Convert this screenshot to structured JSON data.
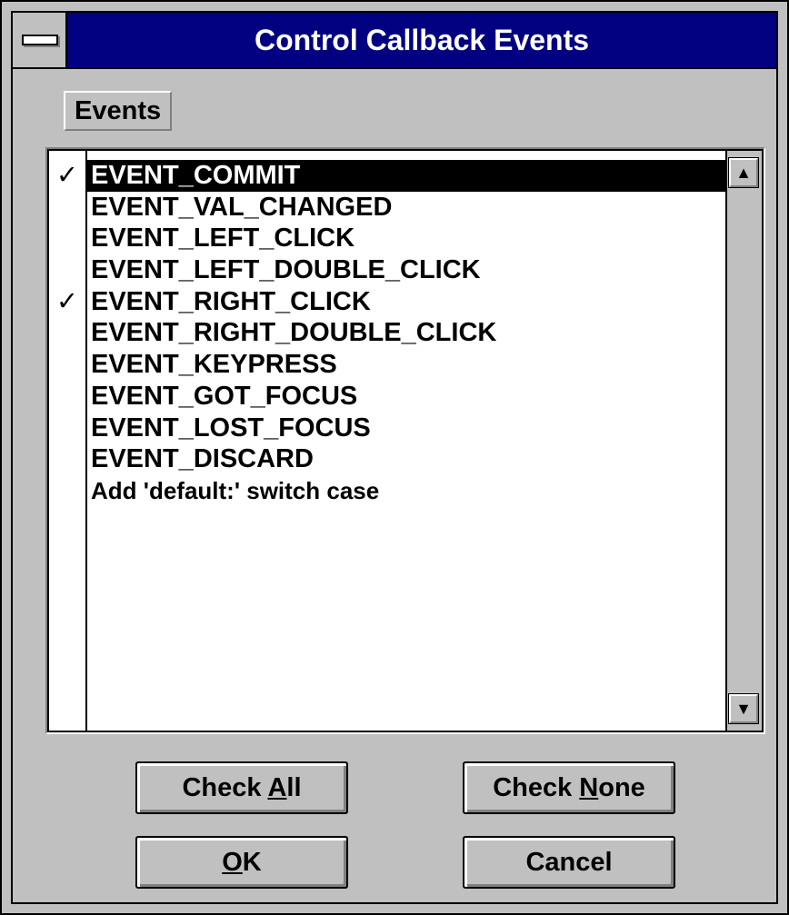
{
  "window": {
    "title": "Control Callback Events"
  },
  "group_label": "Events",
  "events": [
    {
      "label": "EVENT_COMMIT",
      "checked": true,
      "selected": true
    },
    {
      "label": "EVENT_VAL_CHANGED",
      "checked": false,
      "selected": false
    },
    {
      "label": "EVENT_LEFT_CLICK",
      "checked": false,
      "selected": false
    },
    {
      "label": "EVENT_LEFT_DOUBLE_CLICK",
      "checked": false,
      "selected": false
    },
    {
      "label": "EVENT_RIGHT_CLICK",
      "checked": true,
      "selected": false
    },
    {
      "label": "EVENT_RIGHT_DOUBLE_CLICK",
      "checked": false,
      "selected": false
    },
    {
      "label": "EVENT_KEYPRESS",
      "checked": false,
      "selected": false
    },
    {
      "label": "EVENT_GOT_FOCUS",
      "checked": false,
      "selected": false
    },
    {
      "label": "EVENT_LOST_FOCUS",
      "checked": false,
      "selected": false
    },
    {
      "label": "EVENT_DISCARD",
      "checked": false,
      "selected": false
    },
    {
      "label": "Add 'default:' switch case",
      "checked": false,
      "selected": false
    }
  ],
  "check_mark": "✓",
  "scrollbar": {
    "up_icon": "▲",
    "down_icon": "▼"
  },
  "buttons": {
    "check_all": {
      "pre": "Check ",
      "mnemonic": "A",
      "post": "ll"
    },
    "check_none": {
      "pre": "Check ",
      "mnemonic": "N",
      "post": "one"
    },
    "ok": {
      "pre": "",
      "mnemonic": "O",
      "post": "K"
    },
    "cancel": {
      "pre": "Cancel",
      "mnemonic": "",
      "post": ""
    }
  },
  "colors": {
    "titlebar": "#000080",
    "face": "#c0c0c0",
    "selection": "#000000"
  }
}
